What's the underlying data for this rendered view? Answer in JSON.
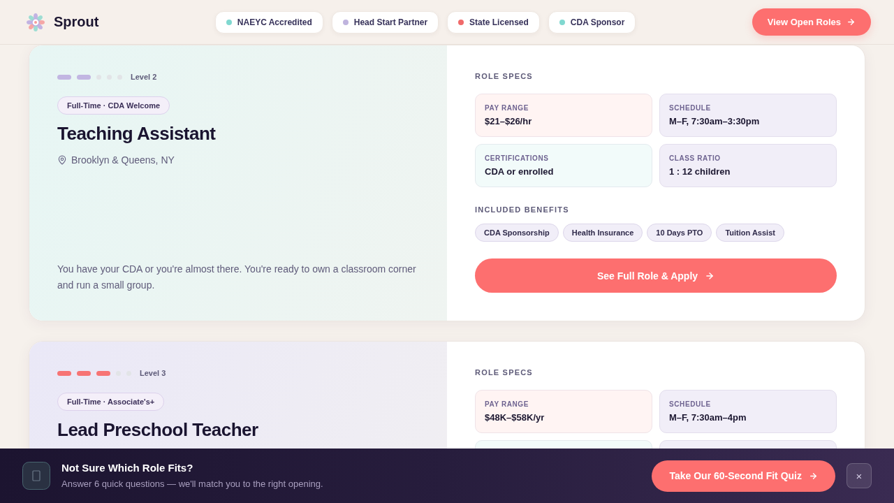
{
  "header": {
    "brand": "Sprout",
    "badges": [
      {
        "label": "NAEYC Accredited",
        "color": "#80d8d0"
      },
      {
        "label": "Head Start Partner",
        "color": "#bfb4de"
      },
      {
        "label": "State Licensed",
        "color": "#f06a6a"
      },
      {
        "label": "CDA Sponsor",
        "color": "#80d8d0"
      }
    ],
    "cta": "View Open Roles"
  },
  "roles": [
    {
      "level": 0.4,
      "level_label": "Level 2",
      "color": "#c2b6e2",
      "panel": {
        "color": "#e7f6f4"
      },
      "tag": "Full-Time · CDA Welcome",
      "title": "Teaching Assistant",
      "location": "Brooklyn & Queens, NY",
      "description": "You have your CDA or you're almost there. You're ready to own a classroom corner and run a small group.",
      "specs_heading": "ROLE SPECS",
      "specs": [
        {
          "label": "PAY RANGE",
          "value": "$21–$26/hr",
          "color": "#fff4f3"
        },
        {
          "label": "SCHEDULE",
          "value": "M–F, 7:30am–3:30pm",
          "color": "#f1eef8"
        },
        {
          "label": "CERTIFICATIONS",
          "value": "CDA or enrolled",
          "color": "#f2fbfa"
        },
        {
          "label": "CLASS RATIO",
          "value": "1 : 12 children",
          "color": "#f1eef8"
        }
      ],
      "benefits_heading": "INCLUDED BENEFITS",
      "benefits": [
        "CDA Sponsorship",
        "Health Insurance",
        "10 Days PTO",
        "Tuition Assist"
      ],
      "apply": "See Full Role & Apply"
    },
    {
      "level": 0.6,
      "level_label": "Level 3",
      "color": "#f77474",
      "panel": {
        "color": "#eae8f7"
      },
      "tag": "Full-Time · Associate's+",
      "title": "Lead Preschool Teacher",
      "specs_heading": "ROLE SPECS",
      "specs": [
        {
          "label": "PAY RANGE",
          "value": "$48K–$58K/yr",
          "color": "#fff4f3"
        },
        {
          "label": "SCHEDULE",
          "value": "M–F, 7:30am–4pm",
          "color": "#f1eef8"
        },
        {
          "color": "#f2fbfa"
        },
        {
          "color": "#f1eef8"
        }
      ]
    }
  ],
  "quiz_bar": {
    "title": "Not Sure Which Role Fits?",
    "subtitle": "Answer 6 quick questions — we'll match you to the right opening.",
    "button": "Take Our 60-Second Fit Quiz",
    "close": "×"
  }
}
